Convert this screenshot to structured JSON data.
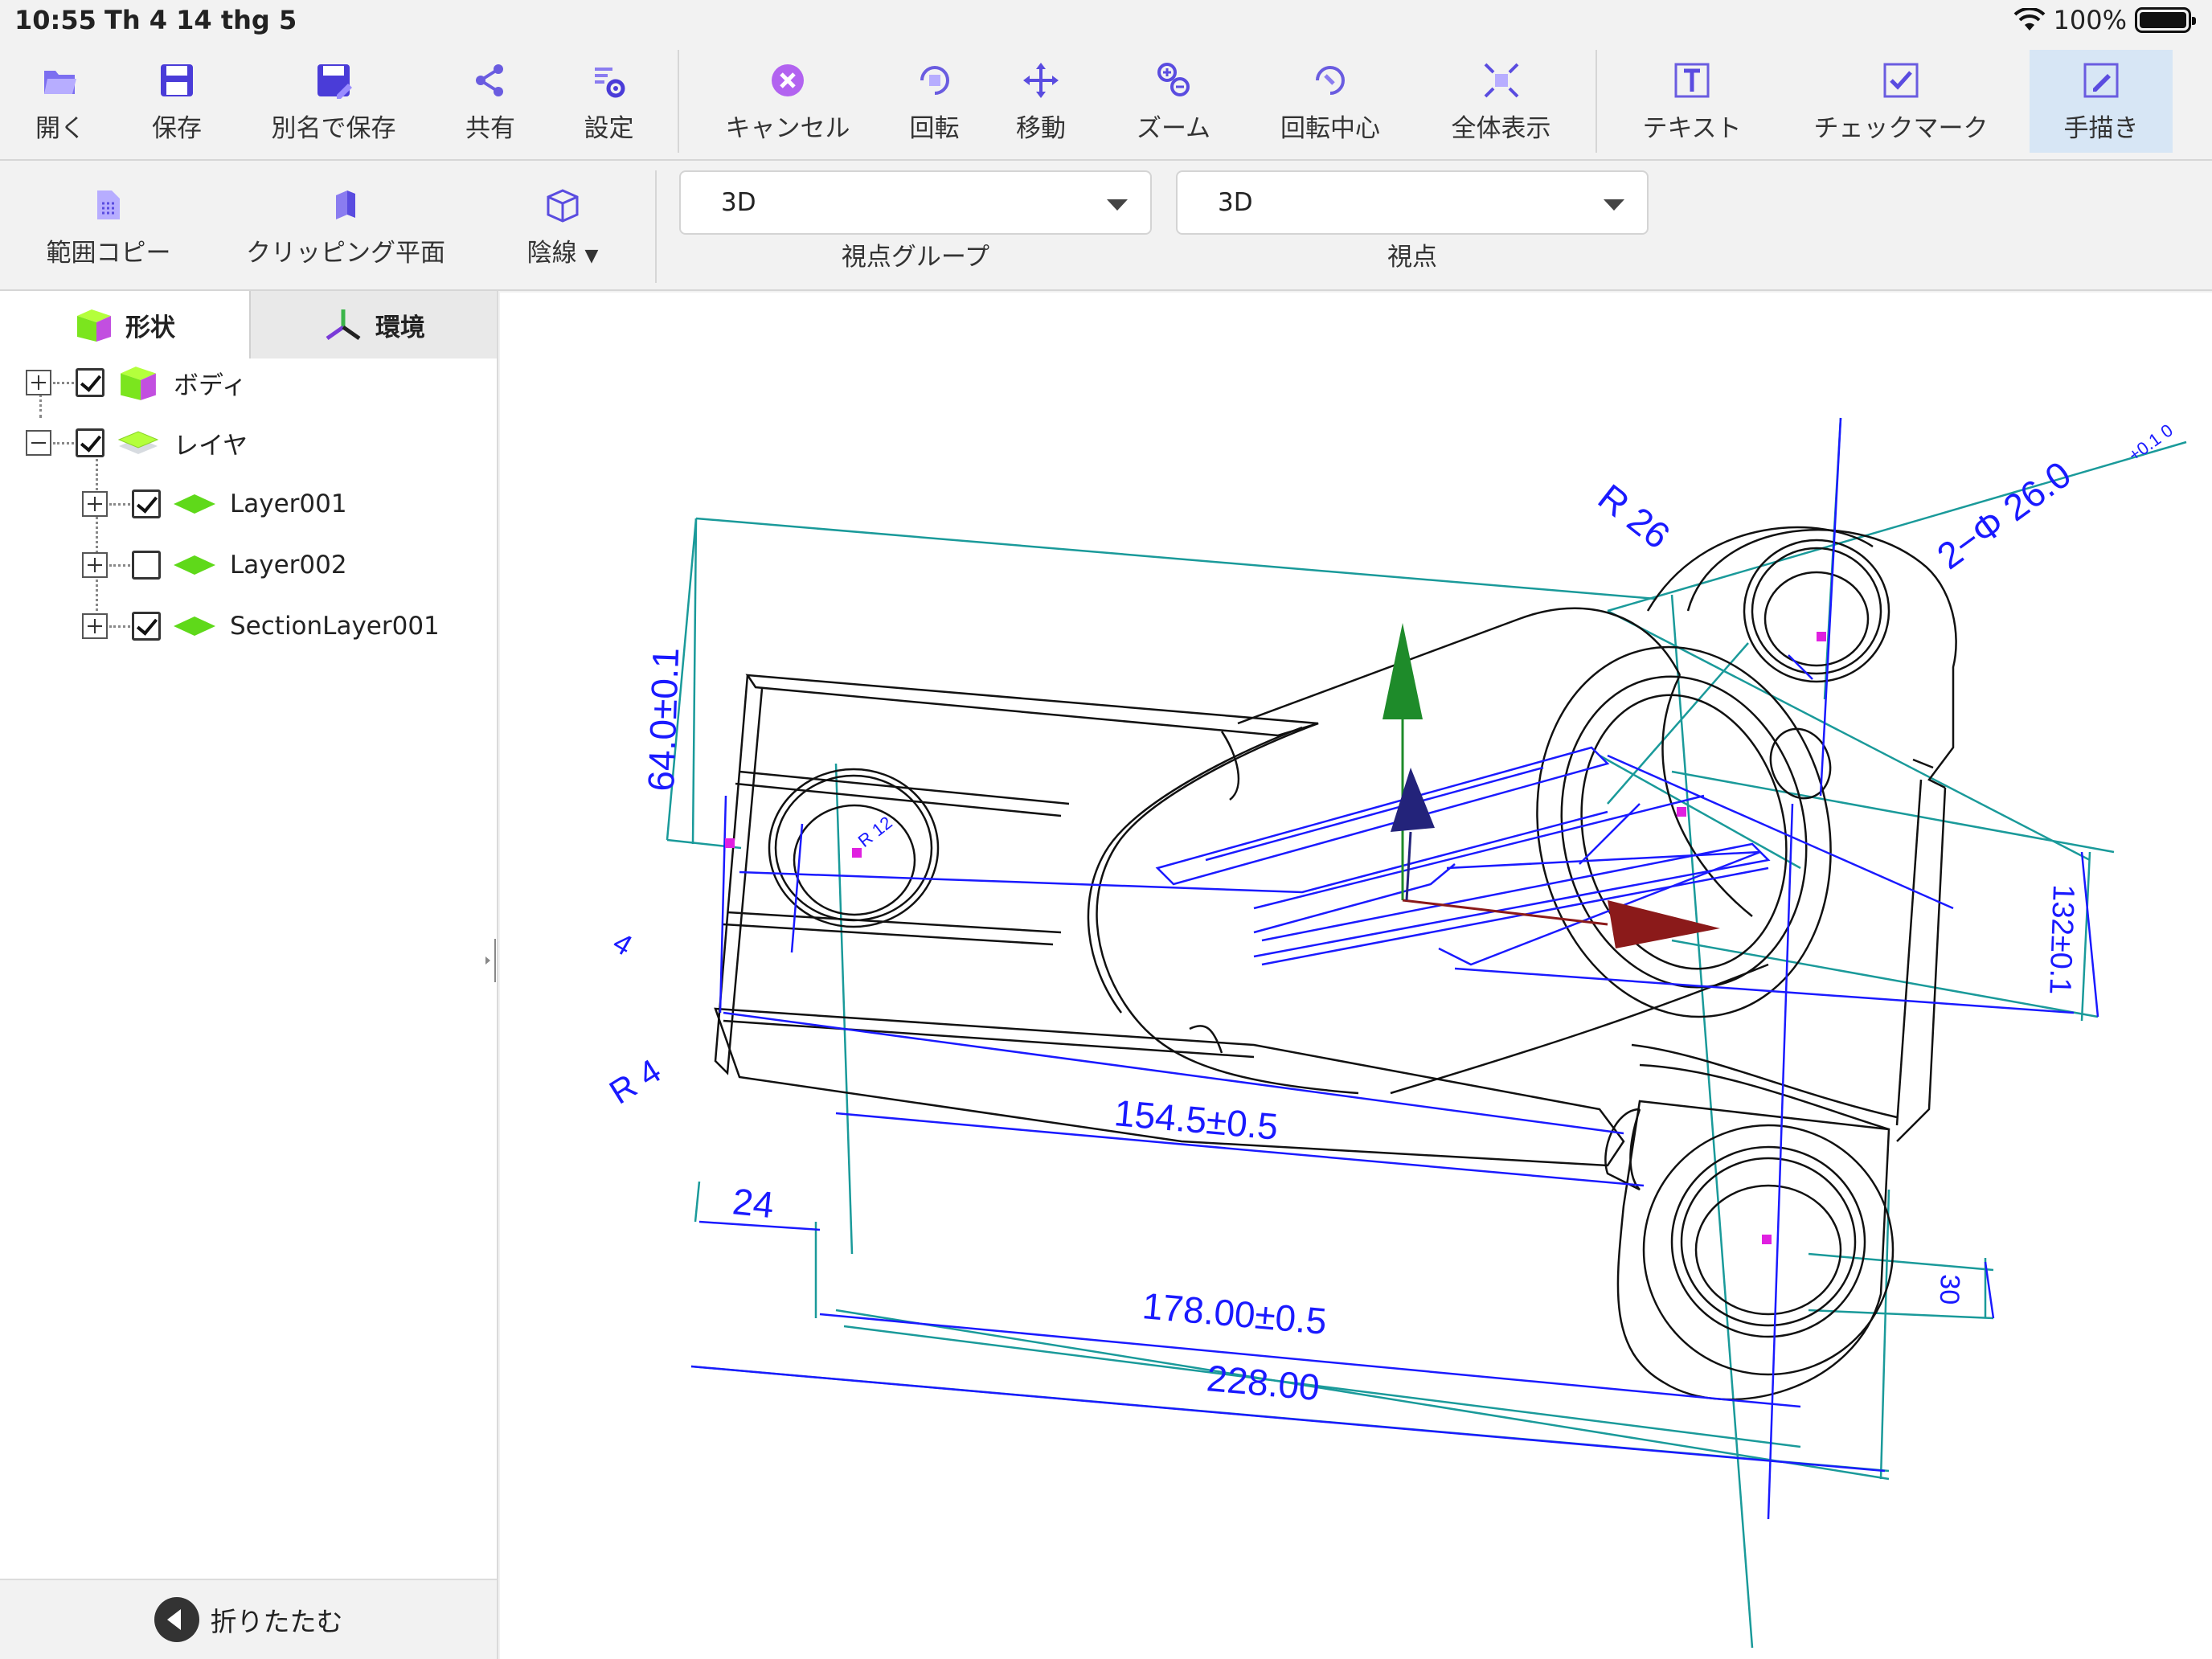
{
  "status": {
    "time": "10:55",
    "date": "Th 4 14 thg 5",
    "battery": "100%"
  },
  "toolbar": {
    "open": "開く",
    "save": "保存",
    "save_as": "別名で保存",
    "share": "共有",
    "settings": "設定",
    "cancel": "キャンセル",
    "rotate": "回転",
    "move": "移動",
    "zoom": "ズーム",
    "rotation_center": "回転中心",
    "fit_all": "全体表示",
    "text": "テキスト",
    "checkmark": "チェックマーク",
    "freehand": "手描き"
  },
  "toolbar2": {
    "range_copy": "範囲コピー",
    "clipping_plane": "クリッピング平面",
    "hidden_line": "陰線",
    "view_group": {
      "value": "3D",
      "caption": "視点グループ"
    },
    "viewpoint": {
      "value": "3D",
      "caption": "視点"
    }
  },
  "panel": {
    "tabs": {
      "shape": "形状",
      "environment": "環境"
    },
    "tree": [
      {
        "label": "ボディ",
        "checked": true,
        "expanded": false
      },
      {
        "label": "レイヤ",
        "checked": true,
        "expanded": true
      },
      {
        "label": "Layer001",
        "checked": true
      },
      {
        "label": "Layer002",
        "checked": false
      },
      {
        "label": "SectionLayer001",
        "checked": true
      }
    ],
    "collapse_label": "折りたたむ"
  },
  "drawing": {
    "dims": {
      "d64": "64.0±0.1",
      "r26": "R 26",
      "phi26": "2−Φ 26.0",
      "tol": "+0.1 0",
      "d154": "154.5±0.5",
      "d24": "24",
      "d178": "178.00±0.5",
      "d228": "228.00",
      "r4": "R 4",
      "d4": "4",
      "d132": "132±0.1",
      "r12": "R 12",
      "d30": "30"
    },
    "colors": {
      "dim": "#1a1aff",
      "ext": "#1a9a9a",
      "line": "#111111",
      "axis_x": "#8b1a1a",
      "axis_y": "#1e8b2a",
      "axis_z": "#23237a"
    }
  }
}
